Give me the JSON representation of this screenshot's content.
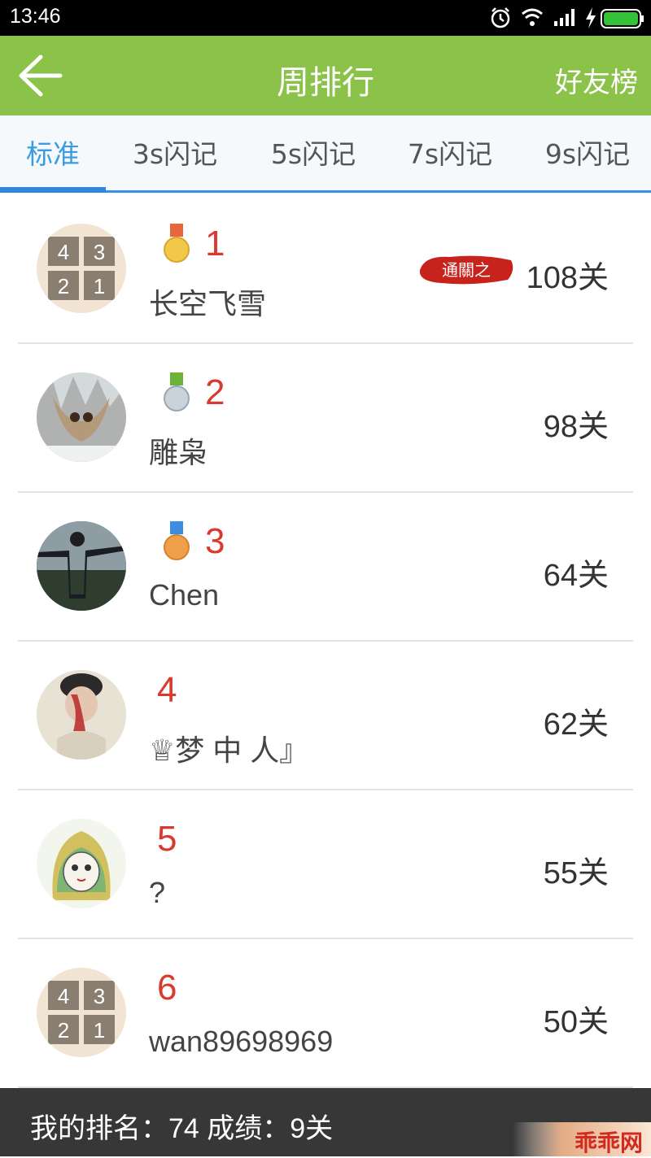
{
  "status_bar": {
    "time": "13:46",
    "icons": [
      "alarm-icon",
      "wifi-icon",
      "signal-icon",
      "charging-icon",
      "battery-icon"
    ],
    "battery_color": "#34c238"
  },
  "app_bar": {
    "title": "周排行",
    "right_action": "好友榜",
    "background": "#8bc34a"
  },
  "tabs": [
    {
      "label": "标准",
      "active": true
    },
    {
      "label": "3s闪记",
      "active": false
    },
    {
      "label": "5s闪记",
      "active": false
    },
    {
      "label": "7s闪记",
      "active": false
    },
    {
      "label": "9s闪记",
      "active": false
    }
  ],
  "accent_color": "#3a9be0",
  "rank_color": "#d93a2f",
  "ranking": [
    {
      "rank": "1",
      "name": "长空飞雪",
      "score": "108关",
      "medal": "gold-medal-icon",
      "badge": "通關之",
      "avatar": "puzzle-4321-avatar"
    },
    {
      "rank": "2",
      "name": "雕枭",
      "score": "98关",
      "medal": "silver-medal-icon",
      "avatar": "owl-photo-avatar"
    },
    {
      "rank": "3",
      "name": "Chen",
      "score": "64关",
      "medal": "bronze-medal-icon",
      "avatar": "person-photo-avatar"
    },
    {
      "rank": "4",
      "name": "♕梦 中 人』",
      "score": "62关",
      "avatar": "portrait-photo-avatar"
    },
    {
      "rank": "5",
      "name": "?",
      "score": "55关",
      "avatar": "cat-drawing-avatar"
    },
    {
      "rank": "6",
      "name": "wan89698969",
      "score": "50关",
      "avatar": "puzzle-4321-avatar"
    }
  ],
  "bottom_bar": {
    "text": "我的排名：74   成绩：9关"
  },
  "watermark": "乖乖网"
}
